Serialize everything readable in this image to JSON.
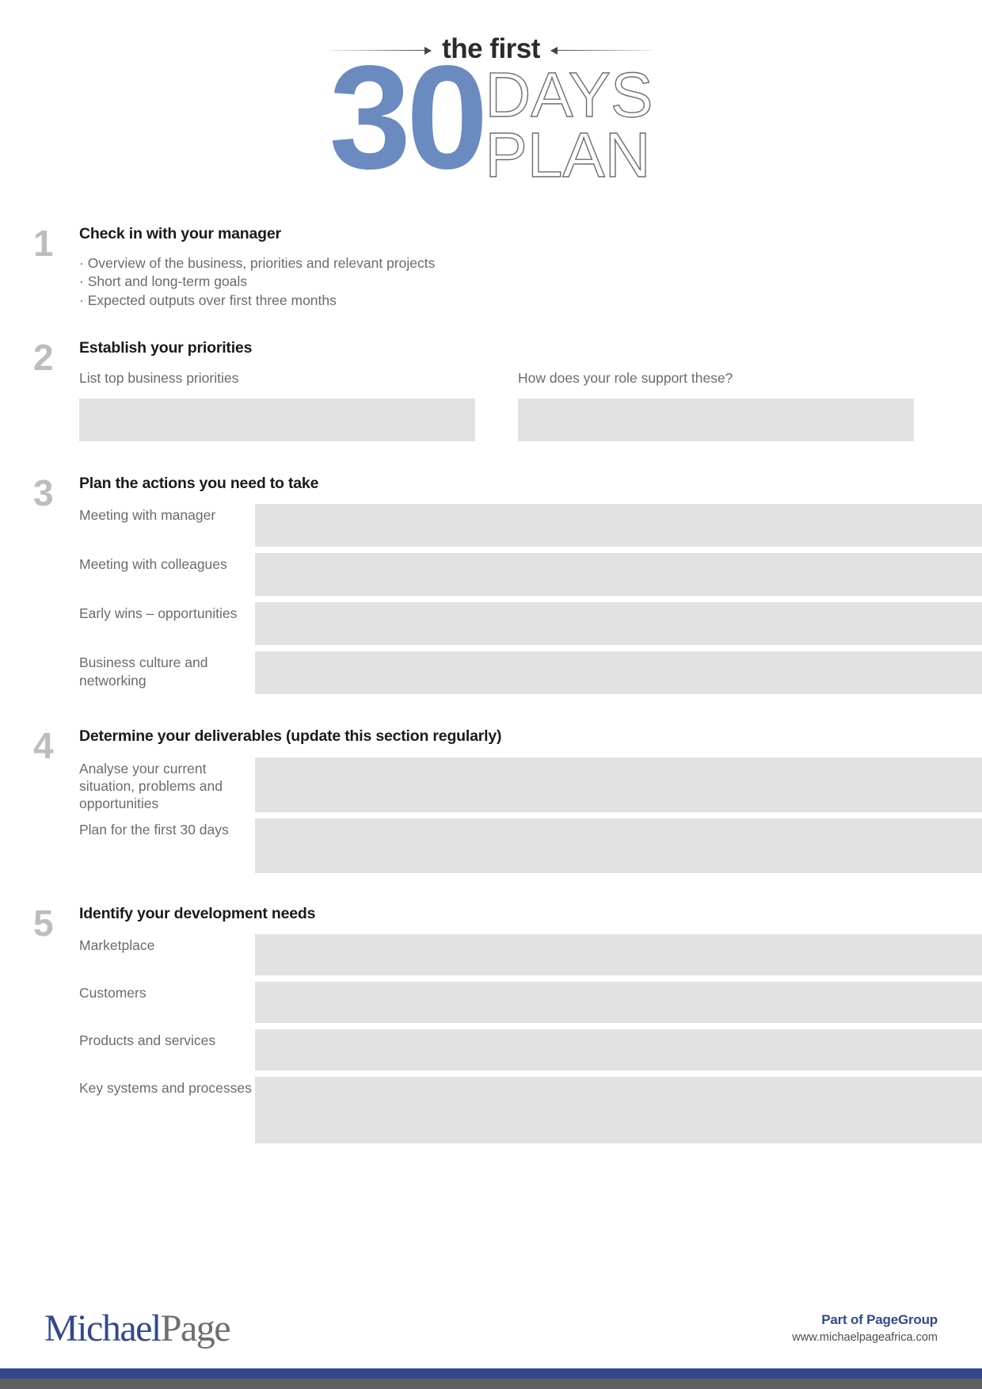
{
  "header": {
    "eyebrow": "the first",
    "big_number": "30",
    "word_days": "DAYS",
    "word_plan": "PLAN",
    "accent_color": "#6a8ac0",
    "outline_color": "#6b6f73"
  },
  "sections": [
    {
      "number": "1",
      "title": "Check in with your manager",
      "bullets": [
        "· Overview of the business, priorities and relevant projects",
        "· Short and long-term goals",
        "· Expected outputs over first three months"
      ]
    },
    {
      "number": "2",
      "title": "Establish your priorities",
      "columns": [
        {
          "label": "List top business priorities",
          "value": ""
        },
        {
          "label": "How does your role support these?",
          "value": ""
        }
      ]
    },
    {
      "number": "3",
      "title": "Plan the actions you need to take",
      "rows": [
        {
          "label": "Meeting with manager",
          "value": ""
        },
        {
          "label": "Meeting with colleagues",
          "value": ""
        },
        {
          "label": "Early wins – opportunities",
          "value": ""
        },
        {
          "label": "Business culture and networking",
          "value": ""
        }
      ]
    },
    {
      "number": "4",
      "title": "Determine your deliverables (update this section regularly)",
      "rows": [
        {
          "label": "Analyse your current situation, problems and opportunities",
          "value": ""
        },
        {
          "label": "Plan for the first 30 days",
          "value": ""
        }
      ]
    },
    {
      "number": "5",
      "title": "Identify your development needs",
      "rows": [
        {
          "label": "Marketplace",
          "value": ""
        },
        {
          "label": "Customers",
          "value": ""
        },
        {
          "label": "Products and services",
          "value": ""
        },
        {
          "label": "Key systems and processes",
          "value": ""
        }
      ]
    }
  ],
  "footer": {
    "logo_first": "Michael",
    "logo_second": "Page",
    "part_of": "Part of PageGroup",
    "website": "www.michaelpageafrica.com",
    "brand_blue": "#33498c",
    "brand_grey": "#5f5f5f"
  }
}
